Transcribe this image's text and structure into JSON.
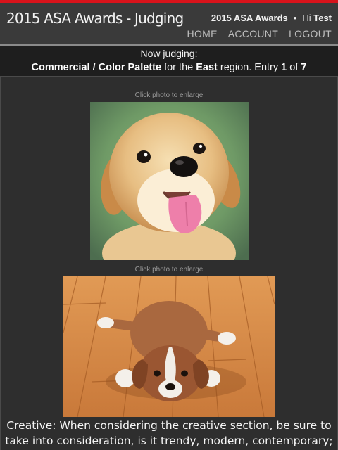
{
  "header": {
    "app_title": "2015 ASA Awards - Judging",
    "event_name": "2015 ASA Awards",
    "separator": "•",
    "greeting": "Hi",
    "username": "Test",
    "nav": [
      "HOME",
      "ACCOUNT",
      "LOGOUT"
    ]
  },
  "judging": {
    "heading": "Now judging:",
    "category": "Commercial / Color Palette",
    "for_text": "for the",
    "region": "East",
    "region_text": "region. Entry",
    "entry_index": "1",
    "of_text": "of",
    "entry_total": "7"
  },
  "photos": [
    {
      "hint": "Click photo to enlarge",
      "subject": "golden puppy face"
    },
    {
      "hint": "Click photo to enlarge",
      "subject": "puppy lying on wooden floor"
    }
  ],
  "description": {
    "line1": "Creative: When considering the creative section, be sure to",
    "line2": "take into consideration, is it trendy, modern, contemporary;"
  },
  "colors": {
    "accent": "#d8131b",
    "header_bg": "#3a3a3a",
    "panel_bg": "#1e1e1e",
    "content_bg": "#2e2e2e"
  }
}
